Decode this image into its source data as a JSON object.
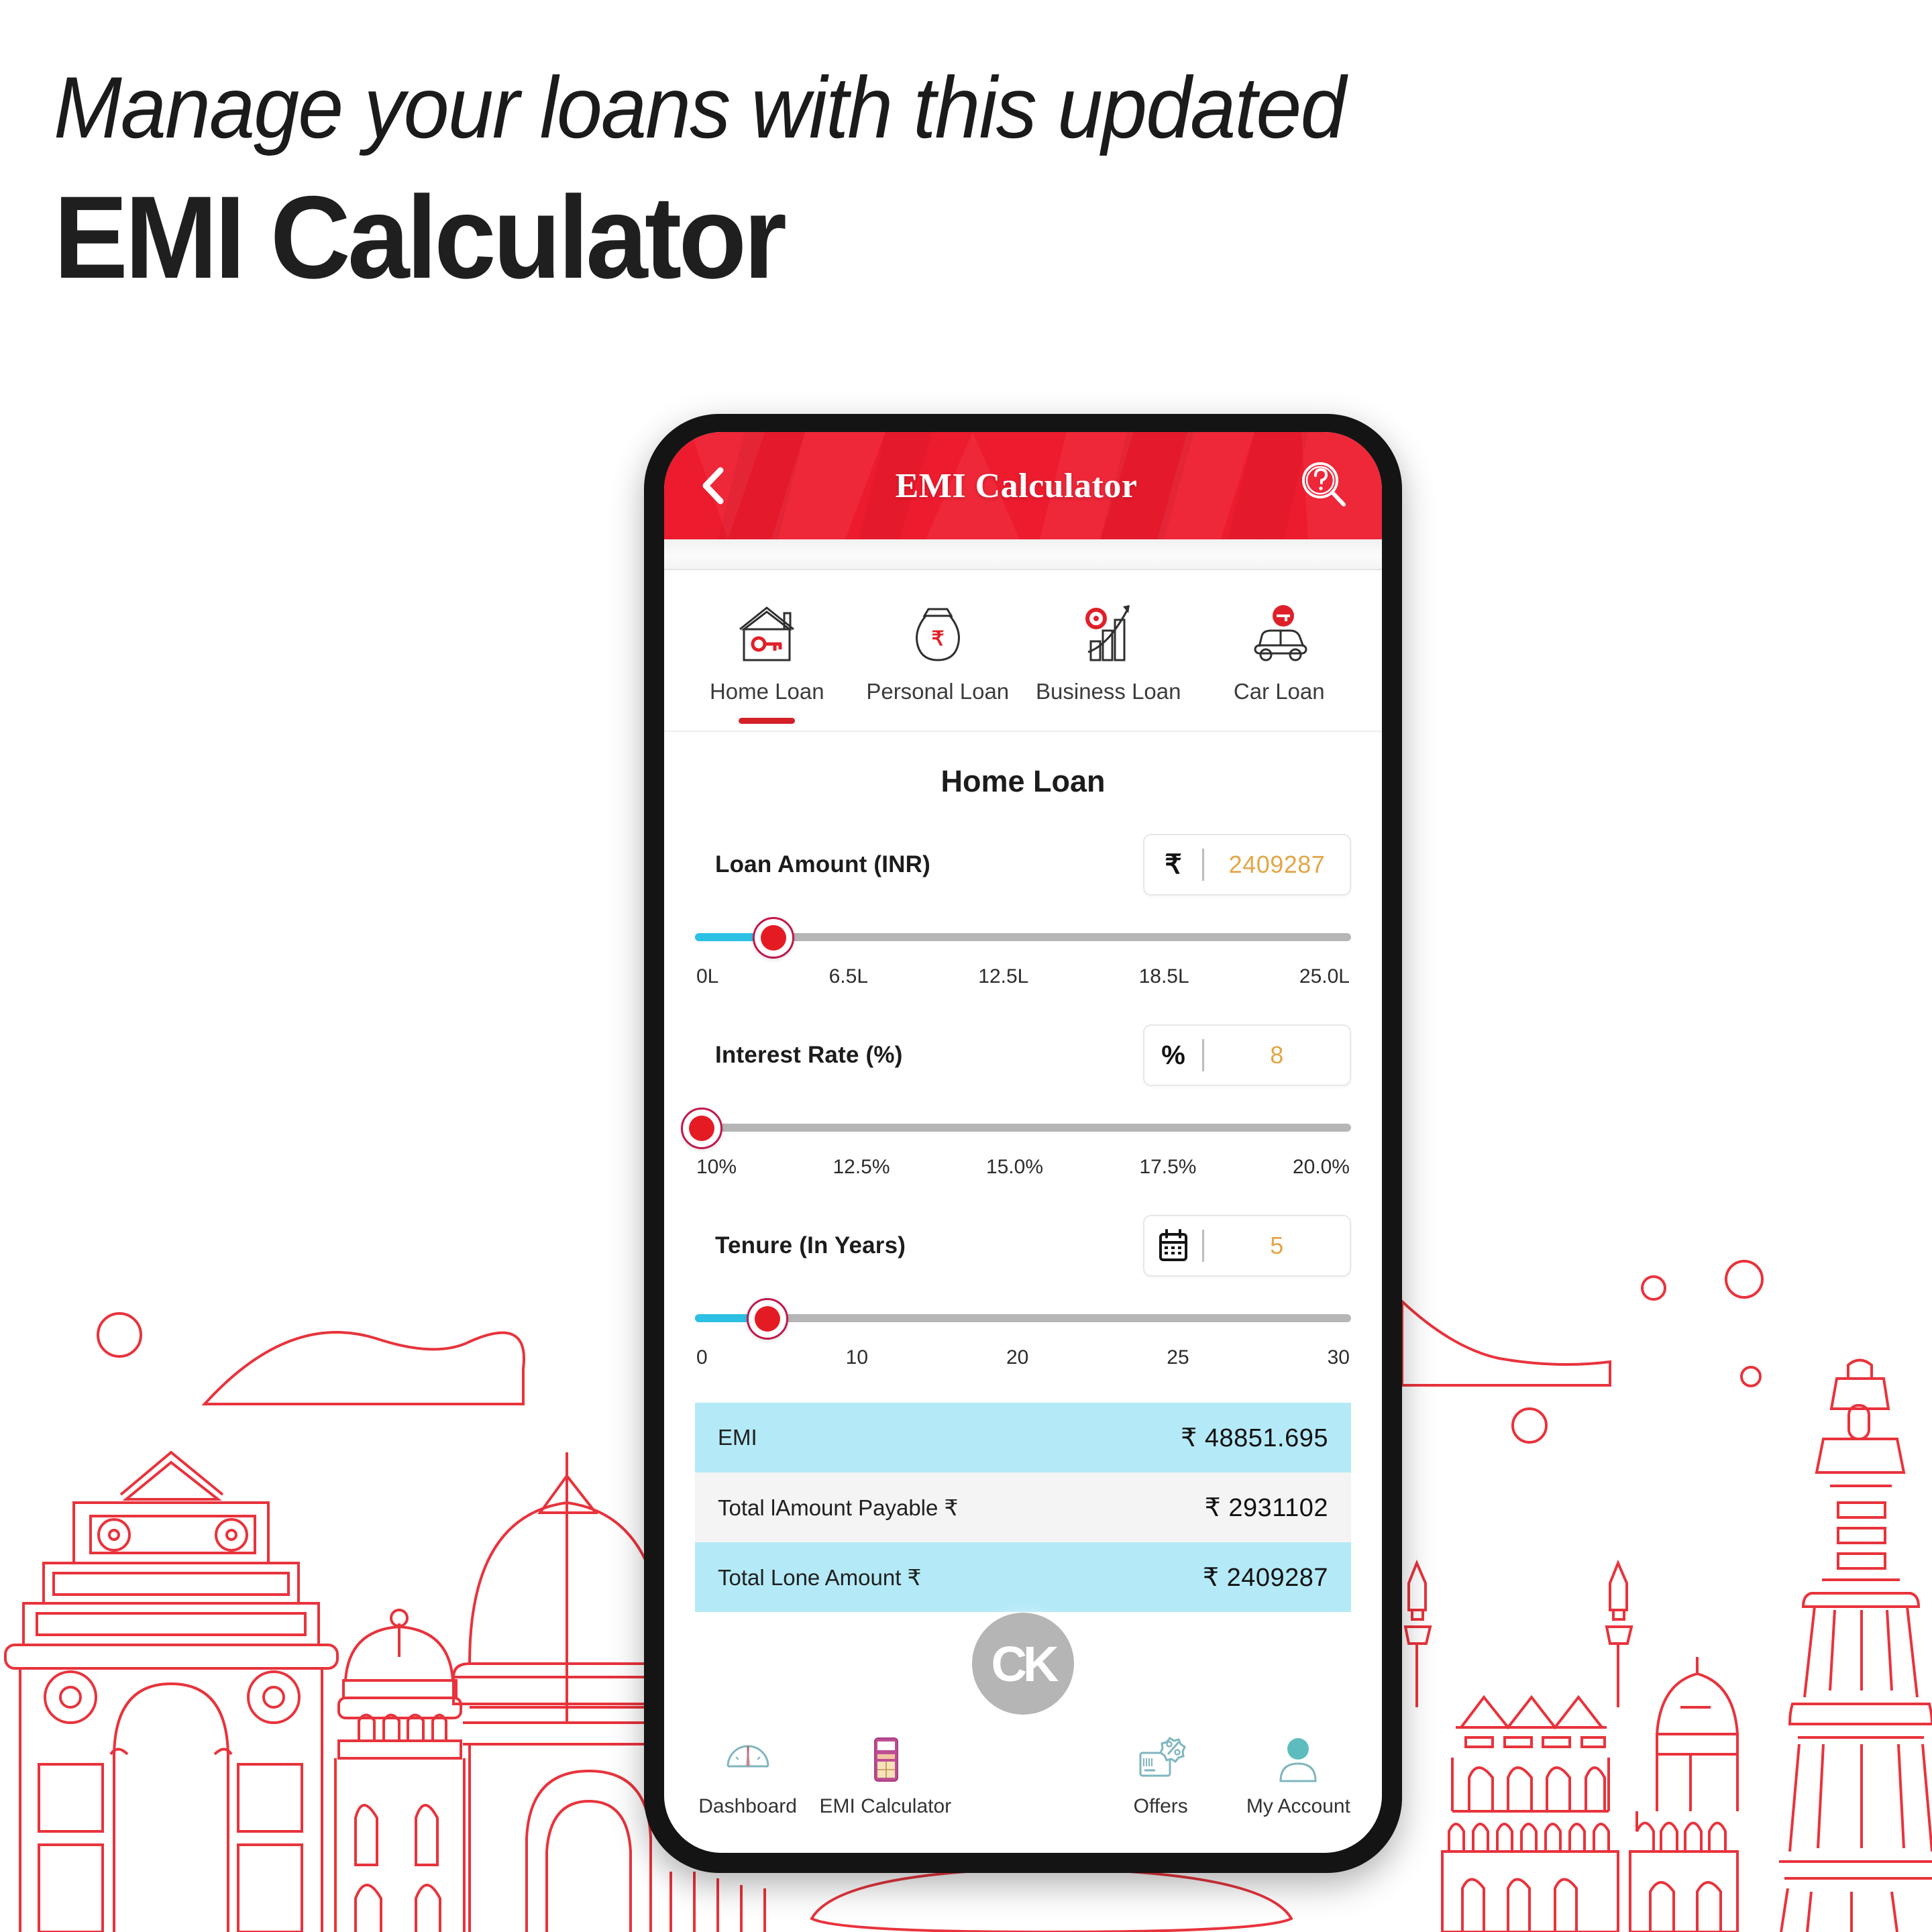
{
  "promo": {
    "line_1": "Manage your loans with this updated",
    "line_2": "EMI Calculator"
  },
  "colors": {
    "brand_red": "#ED1B2E",
    "accent_cyan": "#2BC0E4",
    "result_tint": "#B4EAF7",
    "value_orange": "#E3A647",
    "art_red": "#E8333C"
  },
  "appbar": {
    "back_icon": "chevron-left-icon",
    "title": "EMI Calculator",
    "help_icon": "help-search-icon"
  },
  "loan_tabs": [
    {
      "label": "Home Loan",
      "icon": "house-key-icon",
      "active": true
    },
    {
      "label": "Personal Loan",
      "icon": "money-bag-icon",
      "active": false
    },
    {
      "label": "Business Loan",
      "icon": "growth-chart-icon",
      "active": false
    },
    {
      "label": "Car Loan",
      "icon": "car-icon",
      "active": false
    }
  ],
  "section_title": "Home Loan",
  "fields": [
    {
      "label": "Loan Amount (INR)",
      "unit": "₹",
      "unit_icon": "rupee-icon",
      "value": "2409287",
      "slider": {
        "percent": 12,
        "fill": true
      },
      "ticks": [
        "0L",
        "6.5L",
        "12.5L",
        "18.5L",
        "25.0L"
      ]
    },
    {
      "label": "Interest Rate (%)",
      "unit": "%",
      "unit_icon": "percent-icon",
      "value": "8",
      "slider": {
        "percent": 0,
        "fill": false
      },
      "ticks": [
        "10%",
        "12.5%",
        "15.0%",
        "17.5%",
        "20.0%"
      ]
    },
    {
      "label": "Tenure (In Years)",
      "unit": "",
      "unit_icon": "calendar-icon",
      "value": "5",
      "slider": {
        "percent": 11,
        "fill": true
      },
      "ticks": [
        "0",
        "10",
        "20",
        "25",
        "30"
      ]
    }
  ],
  "results": [
    {
      "label": "EMI",
      "value": "₹ 48851.695",
      "tint": "a"
    },
    {
      "label": "Total lAmount Payable ₹",
      "value": "₹ 2931102",
      "tint": "b"
    },
    {
      "label": "Total Lone Amount ₹",
      "value": "₹ 2409287",
      "tint": "a"
    }
  ],
  "watermark": {
    "text": "CK"
  },
  "bottom_nav": [
    {
      "label": "Dashboard",
      "icon": "speedometer-icon"
    },
    {
      "label": "EMI Calculator",
      "icon": "calculator-icon"
    },
    {
      "label": "",
      "icon": "spacer"
    },
    {
      "label": "Offers",
      "icon": "offer-tag-icon"
    },
    {
      "label": "My Account",
      "icon": "user-account-icon"
    }
  ]
}
